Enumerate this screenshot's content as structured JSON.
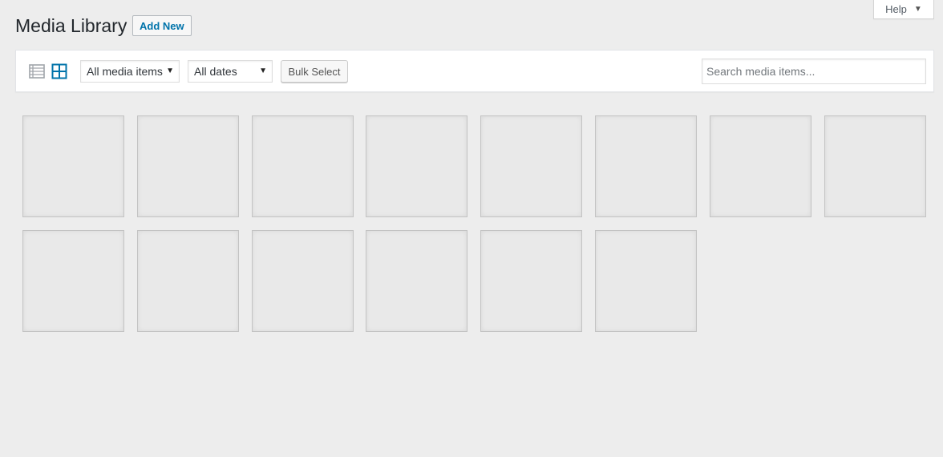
{
  "help": {
    "label": "Help"
  },
  "header": {
    "title": "Media Library",
    "add_new_label": "Add New"
  },
  "toolbar": {
    "view_modes": [
      "list-icon",
      "grid-icon"
    ],
    "active_view": "grid",
    "type_filter": {
      "selected": "All media items"
    },
    "date_filter": {
      "selected": "All dates"
    },
    "bulk_select_label": "Bulk Select",
    "search_placeholder": "Search media items..."
  },
  "colors": {
    "accent": "#0073aa",
    "background": "#ededed",
    "tile": "#e9e9e9"
  },
  "media": {
    "tile_count": 14
  }
}
